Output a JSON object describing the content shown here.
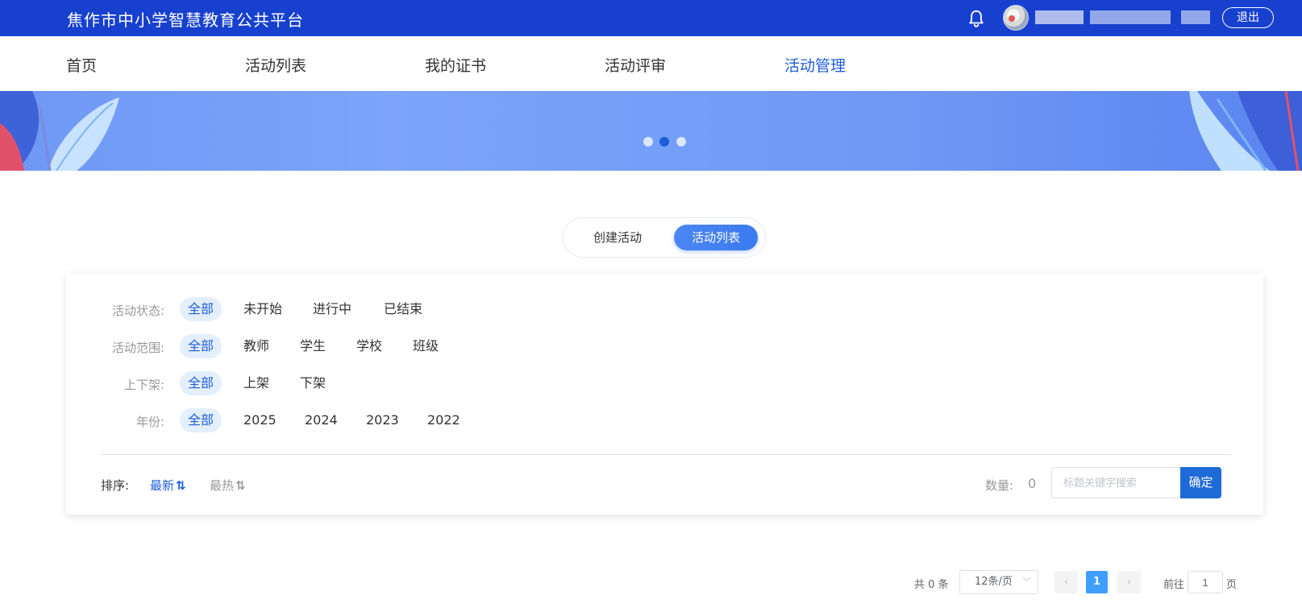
{
  "header": {
    "brand": "焦作市中小学智慧教育公共平台",
    "logout_label": "退出",
    "icons": {
      "bell": "bell-icon",
      "avatar": "avatar"
    }
  },
  "nav": {
    "items": [
      {
        "label": "首页"
      },
      {
        "label": "活动列表"
      },
      {
        "label": "我的证书"
      },
      {
        "label": "活动评审"
      },
      {
        "label": "活动管理"
      }
    ],
    "active_index": 4
  },
  "banner": {
    "dots": 3,
    "active_dot": 1
  },
  "tabs": {
    "create_label": "创建活动",
    "list_label": "活动列表",
    "active": "活动列表"
  },
  "filters": {
    "status": {
      "label": "活动状态:",
      "options": [
        "全部",
        "未开始",
        "进行中",
        "已结束"
      ],
      "active": "全部"
    },
    "scope": {
      "label": "活动范围:",
      "options": [
        "全部",
        "教师",
        "学生",
        "学校",
        "班级"
      ],
      "active": "全部"
    },
    "shelf": {
      "label": "上下架:",
      "options": [
        "全部",
        "上架",
        "下架"
      ],
      "active": "全部"
    },
    "year": {
      "label": "年份:",
      "options": [
        "全部",
        "2025",
        "2024",
        "2023",
        "2022"
      ],
      "active": "全部"
    }
  },
  "sort": {
    "label": "排序:",
    "latest": "最新",
    "hottest": "最热",
    "active": "最新"
  },
  "count": {
    "label": "数量:",
    "value": "0"
  },
  "search": {
    "placeholder": "标题关键字搜索",
    "value": "",
    "button": "确定"
  },
  "pagination": {
    "total": "共 0 条",
    "page_size": "12条/页",
    "current_page": "1",
    "goto_label": "前往",
    "goto_value": "1",
    "goto_unit": "页"
  },
  "colors": {
    "topbar": "#1740cf",
    "accent": "#1e5fd6",
    "page_active": "#409eff"
  }
}
